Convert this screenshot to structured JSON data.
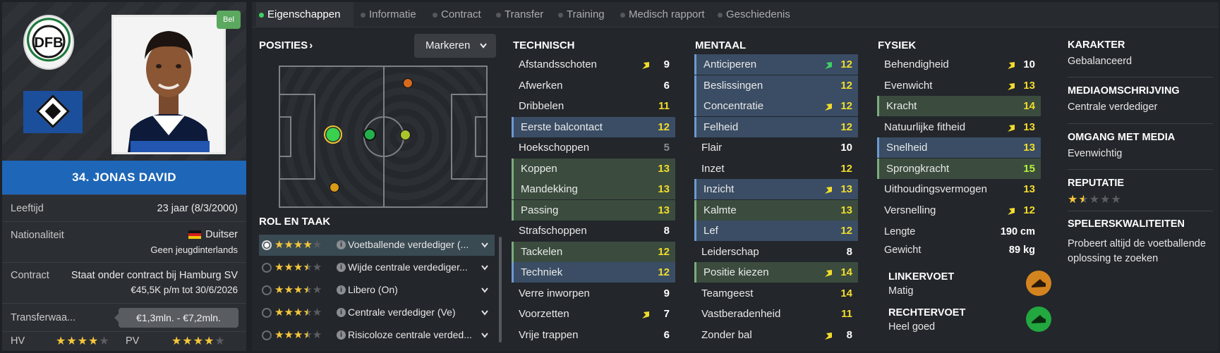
{
  "profile": {
    "badge": "Bel",
    "name": "34. JONAS DAVID",
    "age_label": "Leeftijd",
    "age_value": "23 jaar (8/3/2000)",
    "nationality_label": "Nationaliteit",
    "nationality_value": "Duitser",
    "nationality_sub": "Geen jeugdinterlands",
    "contract_label": "Contract",
    "contract_value": "Staat onder contract bij Hamburg SV",
    "contract_sub": "€45,5K p/m tot 30/6/2026",
    "transfer_label": "Transferwaa...",
    "transfer_value": "€1,3mln. - €7,2mln.",
    "hv_label": "HV",
    "hv_stars": 4,
    "pv_label": "PV",
    "pv_stars": 4,
    "colors": {
      "namebar": "#1e66b7"
    }
  },
  "tabs": [
    {
      "label": "Eigenschappen",
      "active": true
    },
    {
      "label": "Informatie",
      "active": false
    },
    {
      "label": "Contract",
      "active": false
    },
    {
      "label": "Transfer",
      "active": false
    },
    {
      "label": "Training",
      "active": false
    },
    {
      "label": "Medisch rapport",
      "active": false
    },
    {
      "label": "Geschiedenis",
      "active": false
    }
  ],
  "positions": {
    "title": "POSITIES",
    "chevron": "›",
    "markeren_label": "Markeren"
  },
  "roles": {
    "title": "ROL EN TAAK",
    "items": [
      {
        "name": "Voetballende verdediger (...",
        "stars": 4.0,
        "selected": true
      },
      {
        "name": "Wijde centrale verdediger...",
        "stars": 3.5,
        "selected": false
      },
      {
        "name": "Libero (On)",
        "stars": 3.5,
        "selected": false
      },
      {
        "name": "Centrale verdediger (Ve)",
        "stars": 3.5,
        "selected": false
      },
      {
        "name": "Risicoloze centrale verded...",
        "stars": 3.5,
        "selected": false
      }
    ]
  },
  "technisch": {
    "title": "TECHNISCH",
    "items": [
      {
        "name": "Afstandsschoten",
        "value": "9",
        "hl": "",
        "arrow": "up",
        "color": "white"
      },
      {
        "name": "Afwerken",
        "value": "6",
        "hl": "",
        "arrow": "",
        "color": "white"
      },
      {
        "name": "Dribbelen",
        "value": "11",
        "hl": "",
        "arrow": "",
        "color": "yellow"
      },
      {
        "name": "Eerste balcontact",
        "value": "12",
        "hl": "blue",
        "arrow": "",
        "color": "yellow"
      },
      {
        "name": "Hoekschoppen",
        "value": "5",
        "hl": "",
        "arrow": "",
        "color": "grey"
      },
      {
        "name": "Koppen",
        "value": "13",
        "hl": "green",
        "arrow": "",
        "color": "yellow"
      },
      {
        "name": "Mandekking",
        "value": "13",
        "hl": "green",
        "arrow": "",
        "color": "yellow"
      },
      {
        "name": "Passing",
        "value": "13",
        "hl": "green",
        "arrow": "",
        "color": "yellow"
      },
      {
        "name": "Strafschoppen",
        "value": "8",
        "hl": "",
        "arrow": "",
        "color": "white"
      },
      {
        "name": "Tackelen",
        "value": "12",
        "hl": "green",
        "arrow": "",
        "color": "yellow"
      },
      {
        "name": "Techniek",
        "value": "12",
        "hl": "blue",
        "arrow": "",
        "color": "yellow"
      },
      {
        "name": "Verre inworpen",
        "value": "9",
        "hl": "",
        "arrow": "",
        "color": "white"
      },
      {
        "name": "Voorzetten",
        "value": "7",
        "hl": "",
        "arrow": "up",
        "color": "white"
      },
      {
        "name": "Vrije trappen",
        "value": "6",
        "hl": "",
        "arrow": "",
        "color": "white"
      }
    ]
  },
  "mentaal": {
    "title": "MENTAAL",
    "items": [
      {
        "name": "Anticiperen",
        "value": "12",
        "hl": "blue",
        "arrow": "upgreen",
        "color": "yellow"
      },
      {
        "name": "Beslissingen",
        "value": "12",
        "hl": "blue",
        "arrow": "",
        "color": "yellow"
      },
      {
        "name": "Concentratie",
        "value": "12",
        "hl": "blue",
        "arrow": "up",
        "color": "yellow"
      },
      {
        "name": "Felheid",
        "value": "12",
        "hl": "blue",
        "arrow": "",
        "color": "yellow"
      },
      {
        "name": "Flair",
        "value": "10",
        "hl": "",
        "arrow": "",
        "color": "white"
      },
      {
        "name": "Inzet",
        "value": "12",
        "hl": "",
        "arrow": "",
        "color": "yellow"
      },
      {
        "name": "Inzicht",
        "value": "13",
        "hl": "blue",
        "arrow": "up",
        "color": "yellow"
      },
      {
        "name": "Kalmte",
        "value": "13",
        "hl": "green",
        "arrow": "",
        "color": "yellow"
      },
      {
        "name": "Lef",
        "value": "12",
        "hl": "blue",
        "arrow": "",
        "color": "yellow"
      },
      {
        "name": "Leiderschap",
        "value": "8",
        "hl": "",
        "arrow": "",
        "color": "white"
      },
      {
        "name": "Positie kiezen",
        "value": "14",
        "hl": "green",
        "arrow": "up",
        "color": "yellow"
      },
      {
        "name": "Teamgeest",
        "value": "14",
        "hl": "",
        "arrow": "",
        "color": "yellow"
      },
      {
        "name": "Vastberadenheid",
        "value": "11",
        "hl": "",
        "arrow": "",
        "color": "yellow"
      },
      {
        "name": "Zonder bal",
        "value": "8",
        "hl": "",
        "arrow": "up",
        "color": "white"
      }
    ]
  },
  "fysiek": {
    "title": "FYSIEK",
    "items": [
      {
        "name": "Behendigheid",
        "value": "10",
        "hl": "",
        "arrow": "up",
        "color": "white"
      },
      {
        "name": "Evenwicht",
        "value": "13",
        "hl": "",
        "arrow": "up",
        "color": "yellow"
      },
      {
        "name": "Kracht",
        "value": "14",
        "hl": "green",
        "arrow": "",
        "color": "yellow"
      },
      {
        "name": "Natuurlijke fitheid",
        "value": "13",
        "hl": "",
        "arrow": "up",
        "color": "yellow"
      },
      {
        "name": "Snelheid",
        "value": "13",
        "hl": "blue",
        "arrow": "",
        "color": "yellow"
      },
      {
        "name": "Sprongkracht",
        "value": "15",
        "hl": "green",
        "arrow": "",
        "color": "green"
      },
      {
        "name": "Uithoudingsvermogen",
        "value": "13",
        "hl": "",
        "arrow": "",
        "color": "yellow"
      },
      {
        "name": "Versnelling",
        "value": "12",
        "hl": "",
        "arrow": "up",
        "color": "yellow"
      }
    ],
    "lengte_label": "Lengte",
    "lengte_value": "190 cm",
    "gewicht_label": "Gewicht",
    "gewicht_value": "89 kg",
    "linkervoet_label": "LINKERVOET",
    "linkervoet_value": "Matig",
    "rechtervoet_label": "RECHTERVOET",
    "rechtervoet_value": "Heel goed"
  },
  "karakter": {
    "karakter_title": "KARAKTER",
    "karakter_value": "Gebalanceerd",
    "media_title": "MEDIAOMSCHRIJVING",
    "media_value": "Centrale verdediger",
    "omgang_title": "OMGANG MET MEDIA",
    "omgang_value": "Evenwichtig",
    "reputatie_title": "REPUTATIE",
    "reputatie_stars": 1.5,
    "speler_title": "SPELERSKWALITEITEN",
    "speler_value": "Probeert altijd de voetballende oplossing te zoeken"
  }
}
